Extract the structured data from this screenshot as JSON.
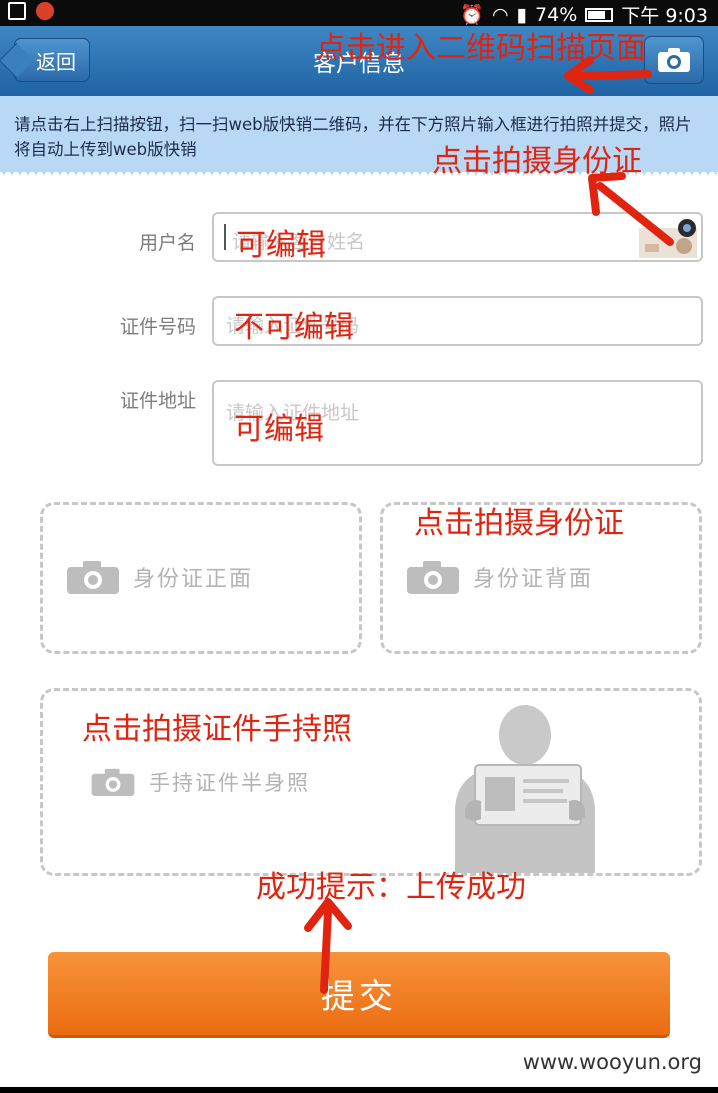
{
  "status_bar": {
    "battery": "74%",
    "time": "下午 9:03"
  },
  "header": {
    "back_label": "返回",
    "title": "客户信息"
  },
  "notice": "请点击右上扫描按钮，扫一扫web版快销二维码，并在下方照片输入框进行拍照并提交，照片将自动上传到web版快销",
  "form": {
    "username": {
      "label": "用户名",
      "placeholder": "请输入客户姓名"
    },
    "id_number": {
      "label": "证件号码",
      "placeholder": "请输入证件号码"
    },
    "id_address": {
      "label": "证件地址",
      "placeholder": "请输入证件地址"
    }
  },
  "photos": {
    "front": "身份证正面",
    "back": "身份证背面",
    "handheld": "手持证件半身照"
  },
  "submit_label": "提交",
  "annotations": {
    "scan": "点击进入二维码扫描页面",
    "shoot_id_top": "点击拍摄身份证",
    "editable_1": "可编辑",
    "not_editable": "不可编辑",
    "editable_2": "可编辑",
    "shoot_id_box": "点击拍摄身份证",
    "shoot_handheld": "点击拍摄证件手持照",
    "success": "成功提示：上传成功"
  },
  "watermark": "www.wooyun.org",
  "colors": {
    "header": "#2a6fae",
    "notice_bg": "#b9d8f6",
    "submit": "#f07f22",
    "annotation": "#e0240f"
  }
}
